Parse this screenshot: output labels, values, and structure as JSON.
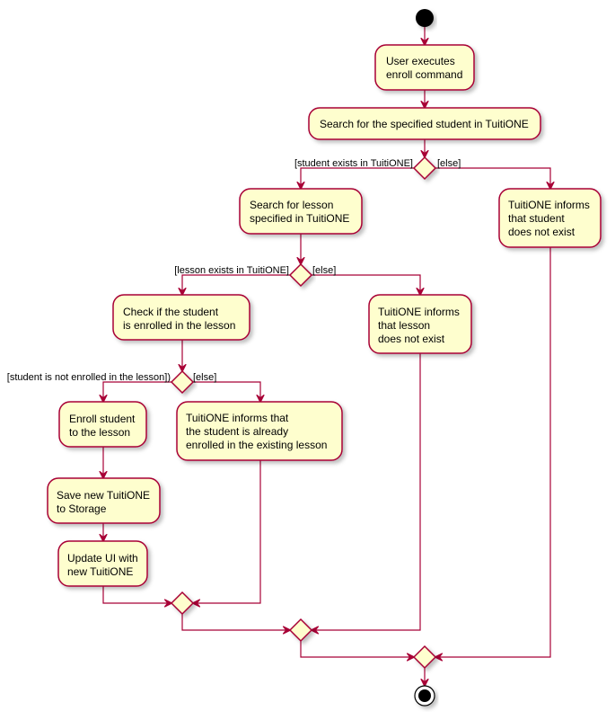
{
  "colors": {
    "border": "#A80036",
    "fill": "#FEFECE",
    "start": "#000000"
  },
  "nodes": {
    "user_executes": {
      "lines": [
        "User executes",
        "enroll command"
      ]
    },
    "search_student": {
      "lines": [
        "Search for the specified student in TuitiONE"
      ]
    },
    "search_lesson": {
      "lines": [
        "Search for lesson",
        "specified in TuitiONE"
      ]
    },
    "student_not_exist": {
      "lines": [
        "TuitiONE informs",
        "that student",
        "does not exist"
      ]
    },
    "check_enrolled": {
      "lines": [
        "Check if the student",
        "is enrolled in the lesson"
      ]
    },
    "lesson_not_exist": {
      "lines": [
        "TuitiONE informs",
        "that lesson",
        "does not exist"
      ]
    },
    "enroll_student": {
      "lines": [
        "Enroll student",
        "to the lesson"
      ]
    },
    "already_enrolled": {
      "lines": [
        "TuitiONE informs that",
        "the student is already",
        "enrolled in the existing lesson"
      ]
    },
    "save_storage": {
      "lines": [
        "Save new TuitiONE",
        "to Storage"
      ]
    },
    "update_ui": {
      "lines": [
        "Update UI with",
        "new TuitiONE"
      ]
    }
  },
  "guards": {
    "student_exists": "[student exists in TuitiONE]",
    "student_else": "[else]",
    "lesson_exists": "[lesson exists in TuitiONE]",
    "lesson_else": "[else]",
    "not_enrolled": "[student is not enrolled in the lesson])",
    "enrolled_else": "[else]"
  }
}
